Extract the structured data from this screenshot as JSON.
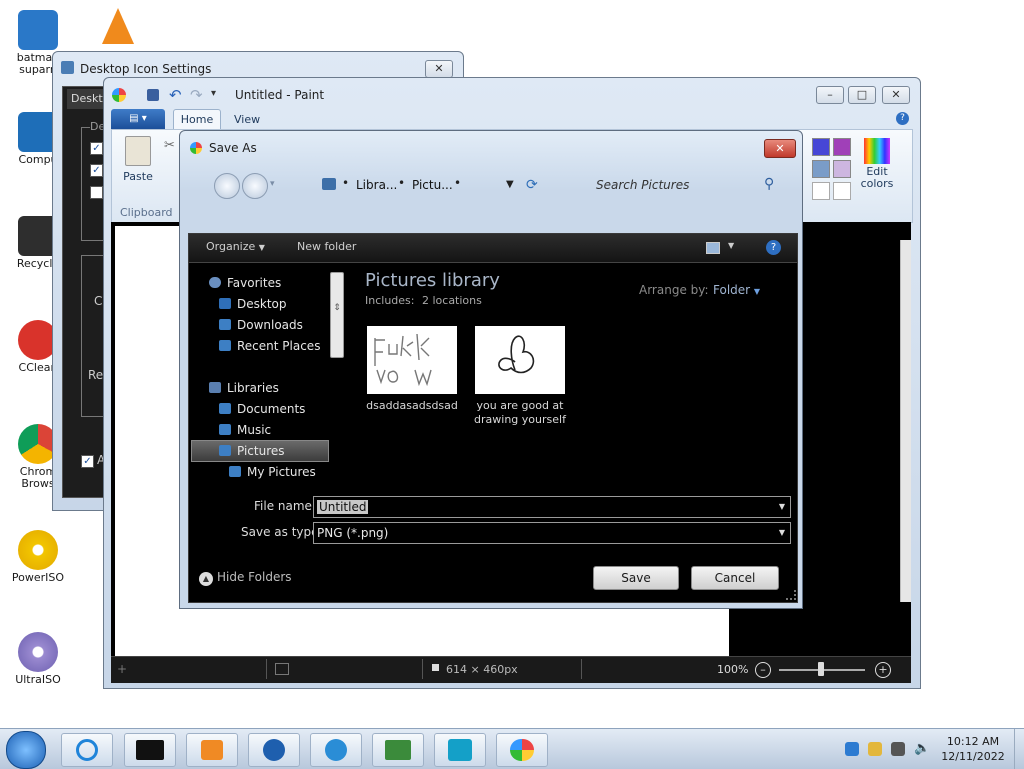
{
  "desktop": {
    "icons": [
      {
        "label": "batman\nsuparn",
        "icon": "app-shortcut-icon"
      },
      {
        "label": "Compu",
        "icon": "computer-icon"
      },
      {
        "label": "Recycle",
        "icon": "recycle-bin-icon"
      },
      {
        "label": "CClean",
        "icon": "ccleaner-icon"
      },
      {
        "label": "Chrom\nBrows",
        "icon": "chrome-icon"
      },
      {
        "label": "PowerISO",
        "icon": "poweriso-icon"
      },
      {
        "label": "UltraISO",
        "icon": "ultraiso-icon"
      }
    ]
  },
  "desktop_icon_settings": {
    "title": "Desktop Icon Settings",
    "tab": "Deskto",
    "partial_texts": [
      "De",
      "C",
      "Re",
      "A"
    ]
  },
  "paint": {
    "title": "Untitled - Paint",
    "tabs": [
      "Home",
      "View"
    ],
    "paste_label": "Paste",
    "clipboard_label": "Clipboard",
    "edit_colors_label": "Edit\ncolors",
    "status": {
      "size": "614 × 460px",
      "zoom": "100%"
    }
  },
  "save_as": {
    "title": "Save As",
    "breadcrumb": [
      "Libra...",
      "Pictu..."
    ],
    "search_placeholder": "Search Pictures",
    "toolbar": {
      "organize": "Organize",
      "new_folder": "New folder"
    },
    "nav": {
      "favorites": "Favorites",
      "desktop": "Desktop",
      "downloads": "Downloads",
      "recent_places": "Recent Places",
      "libraries": "Libraries",
      "documents": "Documents",
      "music": "Music",
      "pictures": "Pictures",
      "my_pictures": "My Pictures"
    },
    "library": {
      "title": "Pictures library",
      "includes_label": "Includes:",
      "locations": "2 locations",
      "arrange_by_label": "Arrange by:",
      "arrange_by_value": "Folder"
    },
    "files": [
      {
        "name": "dsaddasadsdsad"
      },
      {
        "name": "you are good at\ndrawing yourself"
      }
    ],
    "file_name_label": "File name:",
    "file_name_value": "Untitled",
    "save_as_type_label": "Save as type:",
    "save_as_type_value": "PNG (*.png)",
    "hide_folders": "Hide Folders",
    "save_button": "Save",
    "cancel_button": "Cancel"
  },
  "taskbar": {
    "time": "10:12 AM",
    "date": "12/11/2022"
  },
  "colors": {
    "accent": "#1e5fae",
    "dialog_bg": "#000000",
    "selected_nav": "#505050"
  }
}
